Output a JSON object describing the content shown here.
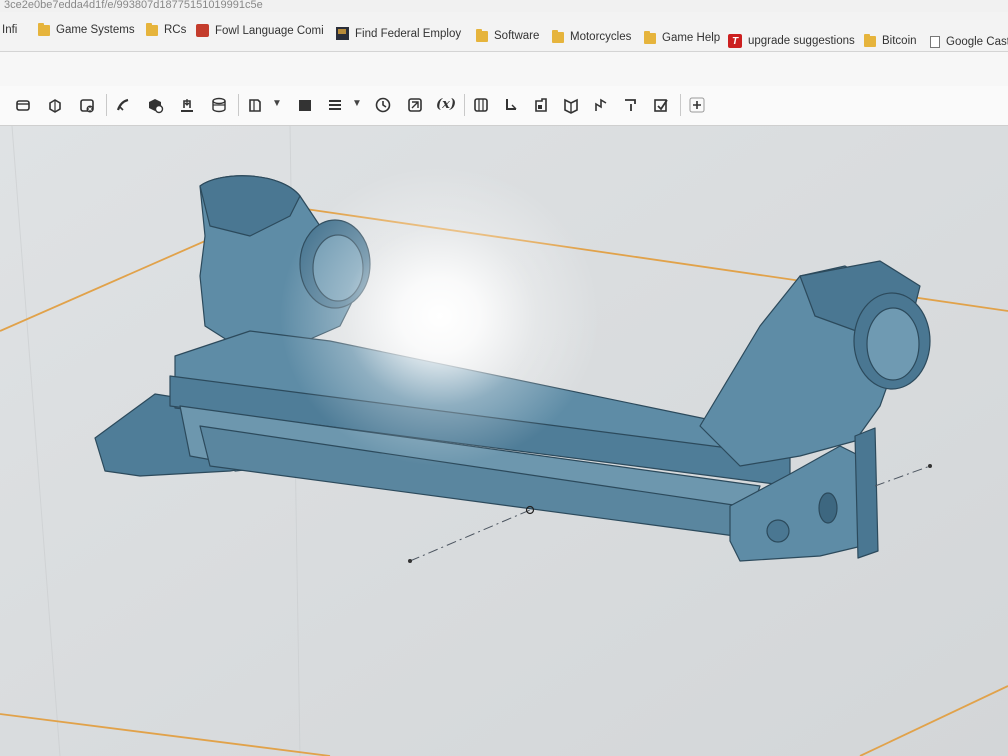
{
  "browser": {
    "url_fragment": "3ce2e0be7edda4d1f/e/993807d18775151019991c5e",
    "bookmarks": [
      {
        "label": "Infi",
        "icon": "folder-icon"
      },
      {
        "label": "Game Systems",
        "icon": "folder-icon"
      },
      {
        "label": "RCs",
        "icon": "folder-icon"
      },
      {
        "label": "Fowl Language Comi",
        "icon": "fowl-language-icon"
      },
      {
        "label": "Find Federal Employ",
        "icon": "flag-icon"
      },
      {
        "label": "Software",
        "icon": "folder-icon"
      },
      {
        "label": "Motorcycles",
        "icon": "folder-icon"
      },
      {
        "label": "Game Help",
        "icon": "folder-icon"
      },
      {
        "label": "upgrade suggestions",
        "icon": "t-logo-icon"
      },
      {
        "label": "Bitcoin",
        "icon": "folder-icon"
      },
      {
        "label": "Google Cast",
        "icon": "page-icon"
      }
    ]
  },
  "toolbar": {
    "variable_label": "(x)",
    "tools": [
      "new-part-studio-icon",
      "extrude-icon",
      "revolve-icon",
      "sweep-icon",
      "loft-icon",
      "fillet-icon",
      "chamfer-icon",
      "shell-icon",
      "mirror-icon",
      "pattern-icon",
      "helix-icon",
      "thicken-icon",
      "history-icon",
      "mate-icon",
      "variable-icon",
      "sheet-metal-icon",
      "flange-icon",
      "tab-icon",
      "bend-icon",
      "joint-icon",
      "corner-icon",
      "finish-icon",
      "add-icon"
    ]
  },
  "colors": {
    "part_fill": "#5e8ca6",
    "part_edge": "#2c4a5c",
    "origin_plane": "#e1a24a",
    "viewport_bg": "#d9dcde"
  }
}
